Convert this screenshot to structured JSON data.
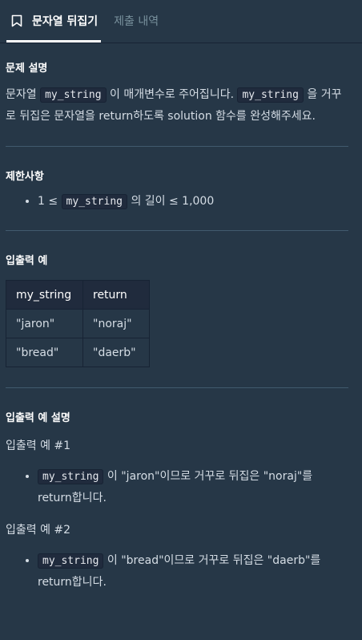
{
  "tabs": {
    "active": "문자열 뒤집기",
    "inactive": "제출 내역"
  },
  "description": {
    "heading": "문제 설명",
    "text1": "문자열 ",
    "code1": "my_string",
    "text2": " 이 매개변수로 주어집니다. ",
    "code2": "my_string",
    "text3": " 을 거꾸로 뒤집은 문자열을 return하도록 solution 함수를 완성해주세요."
  },
  "constraints": {
    "heading": "제한사항",
    "item_pre": "1 ≤ ",
    "item_code": "my_string",
    "item_post": " 의 길이 ≤ 1,000"
  },
  "io_example": {
    "heading": "입출력 예",
    "headers": [
      "my_string",
      "return"
    ],
    "rows": [
      [
        "\"jaron\"",
        "\"noraj\""
      ],
      [
        "\"bread\"",
        "\"daerb\""
      ]
    ]
  },
  "io_explanation": {
    "heading": "입출력 예 설명",
    "ex1_title": "입출력 예 #1",
    "ex1_code": "my_string",
    "ex1_text": " 이 \"jaron\"이므로 거꾸로 뒤집은 \"noraj\"를 return합니다.",
    "ex2_title": "입출력 예 #2",
    "ex2_code": "my_string",
    "ex2_text": " 이 \"bread\"이므로 거꾸로 뒤집은 \"daerb\"를 return합니다."
  }
}
